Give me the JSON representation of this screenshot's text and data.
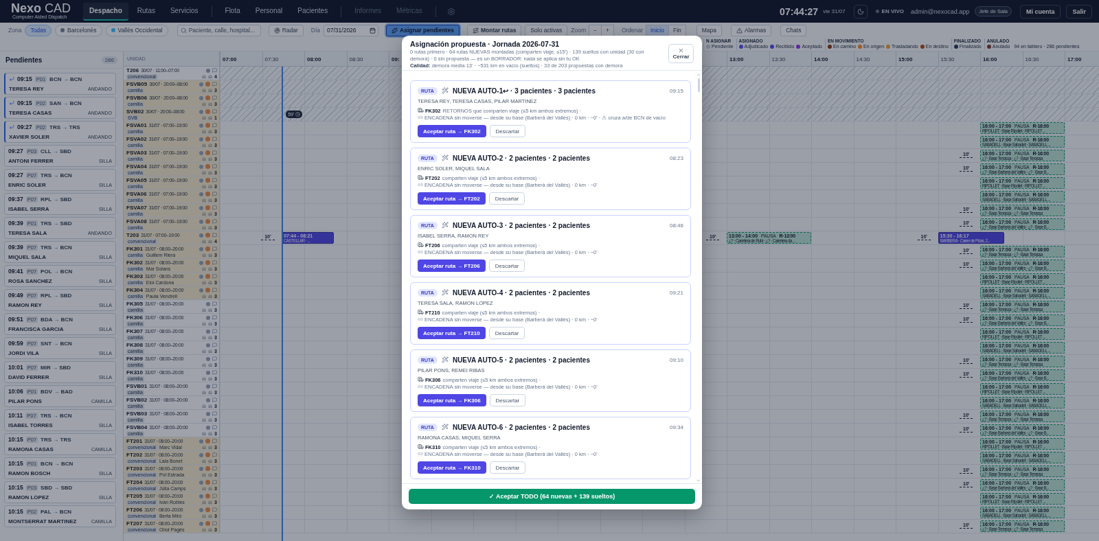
{
  "app": {
    "logo": "**Nexo** CAD",
    "subtitle": "Computer Aided Dispatch"
  },
  "nav_groups": [
    [
      {
        "label": "Despacho",
        "selected": true,
        "disabled": false
      },
      {
        "label": "Rutas",
        "selected": false,
        "disabled": false
      },
      {
        "label": "Servicios",
        "selected": false,
        "disabled": false
      }
    ],
    [
      {
        "label": "Flota",
        "selected": false,
        "disabled": false
      },
      {
        "label": "Personal",
        "selected": false,
        "disabled": false
      },
      {
        "label": "Pacientes",
        "selected": false,
        "disabled": false
      }
    ],
    [
      {
        "label": "Informes",
        "selected": false,
        "disabled": true
      },
      {
        "label": "Métricas",
        "selected": false,
        "disabled": true
      }
    ]
  ],
  "header_right": {
    "clock": "07:44:27",
    "date": "vie 31/07",
    "live": "EN VIVO",
    "user": "admin@nexocad.app",
    "role": "Jefe de Sala",
    "buttons": [
      "Mi cuenta",
      "Salir"
    ]
  },
  "toolbar": {
    "zone_label": "Zona",
    "zones": [
      {
        "label": "Todas",
        "selected": true
      },
      {
        "label": "Barcelonès",
        "selected": false,
        "color": "#4d5668"
      },
      {
        "label": "Vallès Occidental",
        "selected": false,
        "color": "#2e7fa8"
      }
    ],
    "search_placeholder": "Paciente, calle, hospital...",
    "radar": "Radar",
    "day_label": "Día",
    "date": "07/31/2026",
    "assign": "Asignar pendientes",
    "build": "Montar rutas",
    "only_active": "Solo activas",
    "zoom_label": "Zoom",
    "zoom_out": "−",
    "zoom_in": "+",
    "sort_label": "Ordenar",
    "sort": [
      {
        "label": "Inicio",
        "selected": true
      },
      {
        "label": "Fin",
        "selected": false
      }
    ],
    "map": "Mapa",
    "alarms": "Alarmas",
    "chats": "Chats"
  },
  "legend": {
    "groups": [
      {
        "title": "N ASIGNAR",
        "items": [
          {
            "label": "Pendiente",
            "color": "#7d8596"
          }
        ]
      },
      {
        "title": "ASIGNADO",
        "items": [
          {
            "label": "Adjudicado",
            "color": "#3f3aa6"
          },
          {
            "label": "Recibido",
            "color": "#3a35a0"
          },
          {
            "label": "Aceptado",
            "color": "#5b2aa3"
          }
        ]
      },
      {
        "title": "EN MOVIMIENTO",
        "items": [
          {
            "label": "En camino",
            "color": "#5a2a1a"
          },
          {
            "label": "En origen",
            "color": "#a85a26"
          },
          {
            "label": "Trasladando",
            "color": "#946a32"
          },
          {
            "label": "En destino",
            "color": "#74341c"
          }
        ]
      },
      {
        "title": "FINALIZADO",
        "items": [
          {
            "label": "Finalizado",
            "color": "#1c2c48"
          }
        ]
      },
      {
        "title": "ANULADO",
        "items": [
          {
            "label": "Anulado",
            "color": "#532b30"
          }
        ]
      }
    ],
    "summary": "94 en tablero · 286 pendientes"
  },
  "pending": {
    "title": "Pendientes",
    "count": "286",
    "items": [
      {
        "return": true,
        "time": "09:15",
        "priority": "P01",
        "route": "BCN → BCN",
        "name": "TERESA REY",
        "mobility": "ANDANDO"
      },
      {
        "return": true,
        "time": "09:15",
        "priority": "P02",
        "route": "SAN → BCN",
        "name": "TERESA CASAS",
        "mobility": "ANDANDO"
      },
      {
        "return": true,
        "time": "09:27",
        "priority": "P02",
        "route": "TRS → TRS",
        "name": "XAVIER SOLER",
        "mobility": "ANDANDO"
      },
      {
        "return": false,
        "time": "09:27",
        "priority": "P03",
        "route": "CLL → SBD",
        "name": "ANTONI FERRER",
        "mobility": "SILLA"
      },
      {
        "return": false,
        "time": "09:27",
        "priority": "P07",
        "route": "TRS → BCN",
        "name": "ENRIC SOLER",
        "mobility": "SILLA"
      },
      {
        "return": false,
        "time": "09:37",
        "priority": "P07",
        "route": "RPL → SBD",
        "name": "ISABEL SERRA",
        "mobility": "SILLA"
      },
      {
        "return": false,
        "time": "09:39",
        "priority": "P01",
        "route": "TRS → SBD",
        "name": "TERESA SALA",
        "mobility": "ANDANDO"
      },
      {
        "return": false,
        "time": "09:39",
        "priority": "P07",
        "route": "TRS → BCN",
        "name": "MIQUEL SALA",
        "mobility": "SILLA"
      },
      {
        "return": false,
        "time": "09:41",
        "priority": "P07",
        "route": "POL → BCN",
        "name": "ROSA SANCHEZ",
        "mobility": "SILLA"
      },
      {
        "return": false,
        "time": "09:49",
        "priority": "P07",
        "route": "RPL → SBD",
        "name": "RAMON REY",
        "mobility": "SILLA"
      },
      {
        "return": false,
        "time": "09:51",
        "priority": "P07",
        "route": "BDA → BCN",
        "name": "FRANCISCA GARCIA",
        "mobility": "SILLA"
      },
      {
        "return": false,
        "time": "09:59",
        "priority": "P07",
        "route": "SNT → BCN",
        "name": "JORDI VILA",
        "mobility": "SILLA"
      },
      {
        "return": false,
        "time": "10:01",
        "priority": "P07",
        "route": "MIR → SBD",
        "name": "DAVID FERRER",
        "mobility": "SILLA"
      },
      {
        "return": false,
        "time": "10:06",
        "priority": "P01",
        "route": "BDV → BAD",
        "name": "PILAR PONS",
        "mobility": "CAMILLA"
      },
      {
        "return": false,
        "time": "10:11",
        "priority": "P07",
        "route": "TRS → BCN",
        "name": "ISABEL TORRES",
        "mobility": "SILLA"
      },
      {
        "return": false,
        "time": "10:15",
        "priority": "P07",
        "route": "TRS → TRS",
        "name": "RAMONA CASAS",
        "mobility": "CAMILLA"
      },
      {
        "return": false,
        "time": "10:15",
        "priority": "P01",
        "route": "BCN → BCN",
        "name": "RAMON BOSCH",
        "mobility": "SILLA"
      },
      {
        "return": false,
        "time": "10:15",
        "priority": "P03",
        "route": "SBD → SBD",
        "name": "RAMON LOPEZ",
        "mobility": "SILLA"
      },
      {
        "return": false,
        "time": "10:15",
        "priority": "P02",
        "route": "PAL → BCN",
        "name": "MONTSERRAT MARTINEZ",
        "mobility": "CAMILLA"
      }
    ]
  },
  "timeline": {
    "unit_header": "UNIDAD",
    "ticks": [
      "07:00",
      "07:30",
      "08:00",
      "08:30",
      "09:",
      "13:00",
      "13:30",
      "14:00",
      "14:30",
      "15:00",
      "15:30",
      "16:00",
      "16:30",
      "17:00"
    ]
  },
  "units": [
    {
      "name": "T206",
      "shift": "30/07 · 11:00–07:00",
      "type": "convencional",
      "flagged": false,
      "off_shift": true,
      "capacity": "4"
    },
    {
      "name": "FSVB05",
      "shift": "30/07 · 20:00–08:00",
      "type": "camilla",
      "flagged": true,
      "off_shift": true,
      "capacity": "3"
    },
    {
      "name": "FSVB06",
      "shift": "30/07 · 20:00–08:00",
      "type": "camilla",
      "flagged": true,
      "off_shift": true,
      "capacity": "3"
    },
    {
      "name": "SVB02",
      "shift": "30/07 · 20:00–08:00",
      "type": "SVB",
      "flagged": true,
      "off_shift": true,
      "capacity": "1",
      "marker": "59'"
    },
    {
      "name": "FSVA01",
      "shift": "31/07 · 07:00–19:00",
      "type": "camilla",
      "flagged": true,
      "off_shift": false,
      "capacity": "3",
      "blocks": [
        {
          "kind": "pause",
          "time": "16:00 - 17:00",
          "tag": "PAUSA",
          "ref": "R·16:00",
          "place": "RIPOLLET · Base Ripollet · RIPOLLET ..."
        }
      ]
    },
    {
      "name": "FSVA02",
      "shift": "31/07 · 07:00–19:00",
      "type": "camilla",
      "flagged": true,
      "off_shift": false,
      "capacity": "3",
      "blocks": [
        {
          "kind": "pause",
          "time": "16:00 - 17:00",
          "tag": "PAUSA",
          "ref": "R·16:00",
          "place": "SABADELL · Base Sabadell · SABADELL ..."
        }
      ]
    },
    {
      "name": "FSVA03",
      "shift": "31/07 · 07:00–19:00",
      "type": "camilla",
      "flagged": true,
      "off_shift": false,
      "capacity": "3",
      "blocks": [
        {
          "kind": "pause",
          "time": "16:00 - 17:00",
          "tag": "PAUSA",
          "ref": "R·16:00",
          "place": "¿? · Base Terrassa · ¿? · Base Terrassa",
          "gap": "10'"
        }
      ]
    },
    {
      "name": "FSVA04",
      "shift": "31/07 · 07:00–19:00",
      "type": "camilla",
      "flagged": true,
      "off_shift": false,
      "capacity": "3",
      "blocks": [
        {
          "kind": "pause",
          "time": "16:00 - 17:00",
          "tag": "PAUSA",
          "ref": "R·16:00",
          "place": "¿? · Base Barberà del Vallès · ¿? · Base B...",
          "gap": "10'"
        }
      ]
    },
    {
      "name": "FSVA05",
      "shift": "31/07 · 07:00–19:00",
      "type": "camilla",
      "flagged": true,
      "off_shift": false,
      "capacity": "3",
      "blocks": [
        {
          "kind": "pause",
          "time": "16:00 - 17:00",
          "tag": "PAUSA",
          "ref": "R·16:00",
          "place": "RIPOLLET · Base Ripollet · RIPOLLET ..."
        }
      ]
    },
    {
      "name": "FSVA06",
      "shift": "31/07 · 07:00–19:00",
      "type": "camilla",
      "flagged": true,
      "off_shift": false,
      "capacity": "3",
      "blocks": [
        {
          "kind": "pause",
          "time": "16:00 - 17:00",
          "tag": "PAUSA",
          "ref": "R·16:00",
          "place": "SABADELL · Base Sabadell · SABADELL ..."
        }
      ]
    },
    {
      "name": "FSVA07",
      "shift": "31/07 · 07:00–19:00",
      "type": "camilla",
      "flagged": true,
      "off_shift": false,
      "capacity": "3",
      "blocks": [
        {
          "kind": "pause",
          "time": "16:00 - 17:00",
          "tag": "PAUSA",
          "ref": "R·16:00",
          "place": "¿? · Base Terrassa · ¿? · Base Terrassa",
          "gap": "10'"
        }
      ]
    },
    {
      "name": "FSVA08",
      "shift": "31/07 · 07:00–19:00",
      "type": "camilla",
      "flagged": true,
      "off_shift": false,
      "capacity": "3",
      "blocks": [
        {
          "kind": "pause",
          "time": "16:00 - 17:00",
          "tag": "PAUSA",
          "ref": "R·16:00",
          "place": "¿? · Base Barberà del Vallès · ¿? · Base B...",
          "gap": "10'"
        }
      ]
    },
    {
      "name": "T203",
      "shift": "31/07 · 07:00–19:00",
      "type": "convencional",
      "flagged": true,
      "off_shift": false,
      "capacity": "4",
      "blocks": [
        {
          "kind": "service",
          "time": "07:44 - 08:21",
          "place": "CASTELLAR · ...",
          "gap": "10'"
        },
        {
          "kind": "pause",
          "time": "13:00 - 14:00",
          "tag": "PAUSA",
          "ref": "R·13:00",
          "place": "¿? · Carretera de Rubí · ¿? · Carretera da ...",
          "gap": "10'"
        },
        {
          "kind": "service",
          "time": "15:30 - 16:17",
          "place": "BARBERA · Carrer de Picas, 2...",
          "gap": "10'"
        }
      ]
    },
    {
      "name": "FK301",
      "shift": "31/07 · 08:00–20:00",
      "type": "camilla",
      "person": "Guillem Riera",
      "flagged": true,
      "off_shift": false,
      "capacity": "3",
      "blocks": [
        {
          "kind": "pause",
          "time": "16:00 - 17:00",
          "tag": "PAUSA",
          "ref": "R·16:00",
          "place": "¿? · Base Terrassa · ¿? · Base Terrassa",
          "gap": "10'"
        }
      ]
    },
    {
      "name": "FK302",
      "shift": "31/07 · 08:00–20:00",
      "type": "camilla",
      "person": "Mar Solans",
      "flagged": true,
      "off_shift": false,
      "capacity": "3",
      "blocks": [
        {
          "kind": "pause",
          "time": "16:00 - 17:00",
          "tag": "PAUSA",
          "ref": "R·16:00",
          "place": "¿? · Base Barberà del Vallès · ¿? · Base B...",
          "gap": "10'"
        }
      ]
    },
    {
      "name": "FK303",
      "shift": "31/07 · 08:00–20:00",
      "type": "camilla",
      "person": "Eloi Cardona",
      "flagged": true,
      "off_shift": false,
      "capacity": "3",
      "blocks": [
        {
          "kind": "pause",
          "time": "16:00 - 17:00",
          "tag": "PAUSA",
          "ref": "R·16:00",
          "place": "RIPOLLET · Base Ripollet · RIPOLLET ..."
        }
      ]
    },
    {
      "name": "FK304",
      "shift": "31/07 · 08:00–20:00",
      "type": "camilla",
      "person": "Paula Vendrell",
      "flagged": true,
      "off_shift": false,
      "capacity": "3",
      "blocks": [
        {
          "kind": "pause",
          "time": "16:00 - 17:00",
          "tag": "PAUSA",
          "ref": "R·16:00",
          "place": "SABADELL · Base Sabadell · SABADELL ..."
        }
      ]
    },
    {
      "name": "FK305",
      "shift": "31/07 · 08:00–20:00",
      "type": "camilla",
      "flagged": false,
      "off_shift": false,
      "capacity": "3",
      "blocks": [
        {
          "kind": "pause",
          "time": "16:00 - 17:00",
          "tag": "PAUSA",
          "ref": "R·16:00",
          "place": "¿? · Base Terrassa · ¿? · Base Terrassa",
          "gap": "10'"
        }
      ]
    },
    {
      "name": "FK306",
      "shift": "31/07 · 08:00–20:00",
      "type": "camilla",
      "flagged": false,
      "off_shift": false,
      "capacity": "3",
      "blocks": [
        {
          "kind": "pause",
          "time": "16:00 - 17:00",
          "tag": "PAUSA",
          "ref": "R·16:00",
          "place": "¿? · Base Barberà del Vallès · ¿? · Base B...",
          "gap": "10'"
        }
      ]
    },
    {
      "name": "FK307",
      "shift": "31/07 · 08:00–20:00",
      "type": "camilla",
      "flagged": false,
      "off_shift": false,
      "capacity": "3",
      "blocks": [
        {
          "kind": "pause",
          "time": "16:00 - 17:00",
          "tag": "PAUSA",
          "ref": "R·16:00",
          "place": "RIPOLLET · Base Ripollet · RIPOLLET ..."
        }
      ]
    },
    {
      "name": "FK308",
      "shift": "31/07 · 08:00–20:00",
      "type": "camilla",
      "flagged": false,
      "off_shift": false,
      "capacity": "3",
      "blocks": [
        {
          "kind": "pause",
          "time": "16:00 - 17:00",
          "tag": "PAUSA",
          "ref": "R·16:00",
          "place": "SABADELL · Base Sabadell · SABADELL ..."
        }
      ]
    },
    {
      "name": "FK309",
      "shift": "31/07 · 08:00–20:00",
      "type": "camilla",
      "flagged": false,
      "off_shift": false,
      "capacity": "3",
      "blocks": [
        {
          "kind": "pause",
          "time": "16:00 - 17:00",
          "tag": "PAUSA",
          "ref": "R·16:00",
          "place": "¿? · Base Terrassa · ¿? · Base Terrassa",
          "gap": "10'"
        }
      ]
    },
    {
      "name": "FK310",
      "shift": "31/07 · 08:00–20:00",
      "type": "camilla",
      "flagged": false,
      "off_shift": false,
      "capacity": "3",
      "blocks": [
        {
          "kind": "pause",
          "time": "16:00 - 17:00",
          "tag": "PAUSA",
          "ref": "R·16:00",
          "place": "¿? · Base Barberà del Vallès · ¿? · Base B...",
          "gap": "10'"
        }
      ]
    },
    {
      "name": "FSVB01",
      "shift": "31/07 · 08:00–20:00",
      "type": "camilla",
      "flagged": false,
      "off_shift": false,
      "capacity": "3",
      "blocks": [
        {
          "kind": "pause",
          "time": "16:00 - 17:00",
          "tag": "PAUSA",
          "ref": "R·16:00",
          "place": "RIPOLLET · Base Ripollet · RIPOLLET ..."
        }
      ]
    },
    {
      "name": "FSVB02",
      "shift": "31/07 · 08:00–20:00",
      "type": "camilla",
      "flagged": false,
      "off_shift": false,
      "capacity": "3",
      "blocks": [
        {
          "kind": "pause",
          "time": "16:00 - 17:00",
          "tag": "PAUSA",
          "ref": "R·16:00",
          "place": "SABADELL · Base Sabadell · SABADELL ..."
        }
      ]
    },
    {
      "name": "FSVB03",
      "shift": "31/07 · 08:00–20:00",
      "type": "camilla",
      "flagged": false,
      "off_shift": false,
      "capacity": "3",
      "blocks": [
        {
          "kind": "pause",
          "time": "16:00 - 17:00",
          "tag": "PAUSA",
          "ref": "R·16:00",
          "place": "¿? · Base Terrassa · ¿? · Base Terrassa",
          "gap": "10'"
        }
      ]
    },
    {
      "name": "FSVB04",
      "shift": "31/07 · 08:00–20:00",
      "type": "camilla",
      "flagged": false,
      "off_shift": false,
      "capacity": "3",
      "blocks": [
        {
          "kind": "pause",
          "time": "16:00 - 17:00",
          "tag": "PAUSA",
          "ref": "R·16:00",
          "place": "¿? · Base Barberà del Vallès · ¿? · Base B...",
          "gap": "10'"
        }
      ]
    },
    {
      "name": "FT201",
      "shift": "31/07 · 08:00–20:00",
      "type": "convencional",
      "person": "Marc Vidal",
      "flagged": true,
      "off_shift": false,
      "capacity": "3",
      "blocks": [
        {
          "kind": "pause",
          "time": "16:00 - 17:00",
          "tag": "PAUSA",
          "ref": "R·16:00",
          "place": "RIPOLLET · Base Ripollet · RIPOLLET ..."
        }
      ]
    },
    {
      "name": "FT202",
      "shift": "31/07 · 08:00–20:00",
      "type": "convencional",
      "person": "Laia Bonet",
      "flagged": true,
      "off_shift": false,
      "capacity": "3",
      "blocks": [
        {
          "kind": "pause",
          "time": "16:00 - 17:00",
          "tag": "PAUSA",
          "ref": "R·16:00",
          "place": "SABADELL · Base Sabadell · SABADELL ..."
        }
      ]
    },
    {
      "name": "FT203",
      "shift": "31/07 · 08:00–20:00",
      "type": "convencional",
      "person": "Pol Estrada",
      "flagged": true,
      "off_shift": false,
      "capacity": "3",
      "blocks": [
        {
          "kind": "pause",
          "time": "16:00 - 17:00",
          "tag": "PAUSA",
          "ref": "R·16:00",
          "place": "¿? · Base Terrassa · ¿? · Base Terrassa",
          "gap": "10'"
        }
      ]
    },
    {
      "name": "FT204",
      "shift": "31/07 · 08:00–20:00",
      "type": "convencional",
      "person": "Júlia Camps",
      "flagged": true,
      "off_shift": false,
      "capacity": "3",
      "blocks": [
        {
          "kind": "pause",
          "time": "16:00 - 17:00",
          "tag": "PAUSA",
          "ref": "R·16:00",
          "place": "¿? · Base Barberà del Vallès · ¿? · Base B...",
          "gap": "10'"
        }
      ]
    },
    {
      "name": "FT205",
      "shift": "31/07 · 08:00–20:00",
      "type": "convencional",
      "person": "Iván Robles",
      "flagged": true,
      "off_shift": false,
      "capacity": "3",
      "blocks": [
        {
          "kind": "pause",
          "time": "16:00 - 17:00",
          "tag": "PAUSA",
          "ref": "R·16:00",
          "place": "RIPOLLET · Base Ripollet · RIPOLLET ..."
        }
      ]
    },
    {
      "name": "FT206",
      "shift": "31/07 · 08:00–20:00",
      "type": "convencional",
      "person": "Berta Miró",
      "flagged": true,
      "off_shift": false,
      "capacity": "3",
      "blocks": [
        {
          "kind": "pause",
          "time": "16:00 - 17:00",
          "tag": "PAUSA",
          "ref": "R·16:00",
          "place": "SABADELL · Base Sabadell · SABADELL ..."
        }
      ]
    },
    {
      "name": "FT207",
      "shift": "31/07 · 08:00–20:00",
      "type": "convencional",
      "person": "Oriol Pagès",
      "flagged": true,
      "off_shift": false,
      "capacity": "3",
      "blocks": [
        {
          "kind": "pause",
          "time": "16:00 - 17:00",
          "tag": "PAUSA",
          "ref": "R·16:00",
          "place": "¿? · Base Terrassa · ¿? · Base Terrassa",
          "gap": "10'"
        }
      ]
    }
  ],
  "modal": {
    "title": "Asignación propuesta · Jornada 2026-07-31",
    "summary": "0 rutas primero · 64 rutas NUEVAS montadas (comparten viaje, ≤15') · 139 sueltos con unidad (30 con demora) · 0 sin propuesta — es un BORRADOR: nada se aplica sin tu OK",
    "quality": "**Calidad:** demora media 13' · ~531 km en vacío (sueltos) · 33 de 203 propuestas con demora",
    "close": "Cerrar",
    "proposals": [
      {
        "tag": "RUTA",
        "title": "NUEVA AUTO-1↩ · 3 pacientes · 3 pacientes",
        "time": "09:15",
        "patients": "TERESA REY, TERESA CASAS, PILAR MARTINEZ",
        "unit": "FK302",
        "detail": "RETORNOS que comparten viaje (≤5 km ambos extremos) ·",
        "chain": "ENCADENA sin moverse — desde su base (Barberà del Vallès) · 0 km · ~0' · ⚠ cruza a/de BCN de vacío",
        "accept": "Aceptar ruta → FK302",
        "discard": "Descartar"
      },
      {
        "tag": "RUTA",
        "title": "NUEVA AUTO-2 · 2 pacientes · 2 pacientes",
        "time": "08:23",
        "patients": "ENRIC SOLER, MIQUEL SALA",
        "unit": "FT202",
        "detail": "comparten viaje (≤5 km ambos extremos) ·",
        "chain": "ENCADENA sin moverse — desde su base (Barberà del Vallès) · 0 km · ~0'",
        "accept": "Aceptar ruta → FT202",
        "discard": "Descartar"
      },
      {
        "tag": "RUTA",
        "title": "NUEVA AUTO-3 · 2 pacientes · 2 pacientes",
        "time": "08:46",
        "patients": "ISABEL SERRA, RAMON REY",
        "unit": "FT206",
        "detail": "comparten viaje (≤5 km ambos extremos) ·",
        "chain": "ENCADENA sin moverse — desde su base (Barberà del Vallès) · 0 km · ~0'",
        "accept": "Aceptar ruta → FT206",
        "discard": "Descartar"
      },
      {
        "tag": "RUTA",
        "title": "NUEVA AUTO-4 · 2 pacientes · 2 pacientes",
        "time": "09:21",
        "patients": "TERESA SALA, RAMON LOPEZ",
        "unit": "FT210",
        "detail": "comparten viaje (≤5 km ambos extremos) ·",
        "chain": "ENCADENA sin moverse — desde su base (Barberà del Vallès) · 0 km · ~0'",
        "accept": "Aceptar ruta → FT210",
        "discard": "Descartar"
      },
      {
        "tag": "RUTA",
        "title": "NUEVA AUTO-5 · 2 pacientes · 2 pacientes",
        "time": "09:10",
        "patients": "PILAR PONS, REMEI RIBAS",
        "unit": "FK306",
        "detail": "comparten viaje (≤5 km ambos extremos) ·",
        "chain": "ENCADENA sin moverse — desde su base (Barberà del Vallès) · 0 km · ~0'",
        "accept": "Aceptar ruta → FK306",
        "discard": "Descartar"
      },
      {
        "tag": "RUTA",
        "title": "NUEVA AUTO-6 · 2 pacientes · 2 pacientes",
        "time": "09:34",
        "patients": "RAMONA CASAS, MIQUEL SERRA",
        "unit": "FK310",
        "detail": "comparten viaje (≤5 km ambos extremos) ·",
        "chain": "ENCADENA sin moverse — desde su base (Barberà del Vallès) · 0 km · ~0'",
        "accept": "Aceptar ruta → FK310",
        "discard": "Descartar"
      }
    ],
    "accept_all": "✓ Aceptar TODO (64 nuevas + 139 sueltos)"
  }
}
